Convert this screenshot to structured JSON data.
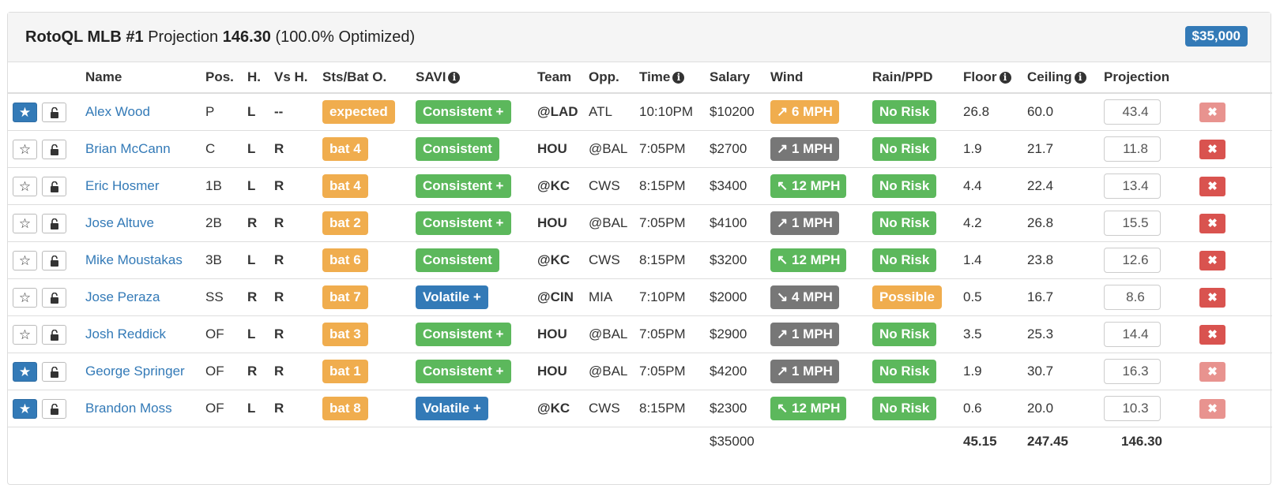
{
  "header": {
    "brand": "RotoQL MLB #1",
    "projection_label": "Projection",
    "projection_value": "146.30",
    "optimized": "(100.0% Optimized)",
    "budget": "$35,000"
  },
  "columns": {
    "name": "Name",
    "pos": "Pos.",
    "hand": "H.",
    "vs_hand": "Vs H.",
    "bat_order": "Sts/Bat O.",
    "savi": "SAVI",
    "team": "Team",
    "opp": "Opp.",
    "time": "Time",
    "salary": "Salary",
    "wind": "Wind",
    "rain": "Rain/PPD",
    "floor": "Floor",
    "ceiling": "Ceiling",
    "projection": "Projection"
  },
  "icons": {
    "info": "info-icon",
    "star": "star-icon",
    "lock": "unlock-icon",
    "remove": "close-icon",
    "wind_arrow": "wind-direction-arrow"
  },
  "colors": {
    "orange": "#f0ad4e",
    "green": "#5cb85c",
    "blue": "#337ab7",
    "gray": "#777777",
    "red": "#d9534f"
  },
  "players": [
    {
      "starred": true,
      "name": "Alex Wood",
      "pos": "P",
      "hand": "L",
      "vs_hand": "--",
      "bat": "expected",
      "savi": "Consistent +",
      "savi_color": "green",
      "team": "@LAD",
      "opp": "ATL",
      "time": "10:10PM",
      "salary": "$10200",
      "wind_arrow": "↗",
      "wind": "6 MPH",
      "wind_color": "orange",
      "rain": "No Risk",
      "rain_color": "green",
      "floor": "26.8",
      "ceiling": "60.0",
      "projection": "43.4",
      "remove_faded": true
    },
    {
      "starred": false,
      "name": "Brian McCann",
      "pos": "C",
      "hand": "L",
      "vs_hand": "R",
      "bat": "bat 4",
      "savi": "Consistent",
      "savi_color": "green",
      "team": "HOU",
      "opp": "@BAL",
      "time": "7:05PM",
      "salary": "$2700",
      "wind_arrow": "↗",
      "wind": "1 MPH",
      "wind_color": "gray",
      "rain": "No Risk",
      "rain_color": "green",
      "floor": "1.9",
      "ceiling": "21.7",
      "projection": "11.8",
      "remove_faded": false
    },
    {
      "starred": false,
      "name": "Eric Hosmer",
      "pos": "1B",
      "hand": "L",
      "vs_hand": "R",
      "bat": "bat 4",
      "savi": "Consistent +",
      "savi_color": "green",
      "team": "@KC",
      "opp": "CWS",
      "time": "8:15PM",
      "salary": "$3400",
      "wind_arrow": "↖",
      "wind": "12 MPH",
      "wind_color": "green",
      "rain": "No Risk",
      "rain_color": "green",
      "floor": "4.4",
      "ceiling": "22.4",
      "projection": "13.4",
      "remove_faded": false
    },
    {
      "starred": false,
      "name": "Jose Altuve",
      "pos": "2B",
      "hand": "R",
      "vs_hand": "R",
      "bat": "bat 2",
      "savi": "Consistent +",
      "savi_color": "green",
      "team": "HOU",
      "opp": "@BAL",
      "time": "7:05PM",
      "salary": "$4100",
      "wind_arrow": "↗",
      "wind": "1 MPH",
      "wind_color": "gray",
      "rain": "No Risk",
      "rain_color": "green",
      "floor": "4.2",
      "ceiling": "26.8",
      "projection": "15.5",
      "remove_faded": false
    },
    {
      "starred": false,
      "name": "Mike Moustakas",
      "pos": "3B",
      "hand": "L",
      "vs_hand": "R",
      "bat": "bat 6",
      "savi": "Consistent",
      "savi_color": "green",
      "team": "@KC",
      "opp": "CWS",
      "time": "8:15PM",
      "salary": "$3200",
      "wind_arrow": "↖",
      "wind": "12 MPH",
      "wind_color": "green",
      "rain": "No Risk",
      "rain_color": "green",
      "floor": "1.4",
      "ceiling": "23.8",
      "projection": "12.6",
      "remove_faded": false
    },
    {
      "starred": false,
      "name": "Jose Peraza",
      "pos": "SS",
      "hand": "R",
      "vs_hand": "R",
      "bat": "bat 7",
      "savi": "Volatile +",
      "savi_color": "blue",
      "team": "@CIN",
      "opp": "MIA",
      "time": "7:10PM",
      "salary": "$2000",
      "wind_arrow": "↘",
      "wind": "4 MPH",
      "wind_color": "gray",
      "rain": "Possible",
      "rain_color": "orange",
      "floor": "0.5",
      "ceiling": "16.7",
      "projection": "8.6",
      "remove_faded": false
    },
    {
      "starred": false,
      "name": "Josh Reddick",
      "pos": "OF",
      "hand": "L",
      "vs_hand": "R",
      "bat": "bat 3",
      "savi": "Consistent +",
      "savi_color": "green",
      "team": "HOU",
      "opp": "@BAL",
      "time": "7:05PM",
      "salary": "$2900",
      "wind_arrow": "↗",
      "wind": "1 MPH",
      "wind_color": "gray",
      "rain": "No Risk",
      "rain_color": "green",
      "floor": "3.5",
      "ceiling": "25.3",
      "projection": "14.4",
      "remove_faded": false
    },
    {
      "starred": true,
      "name": "George Springer",
      "pos": "OF",
      "hand": "R",
      "vs_hand": "R",
      "bat": "bat 1",
      "savi": "Consistent +",
      "savi_color": "green",
      "team": "HOU",
      "opp": "@BAL",
      "time": "7:05PM",
      "salary": "$4200",
      "wind_arrow": "↗",
      "wind": "1 MPH",
      "wind_color": "gray",
      "rain": "No Risk",
      "rain_color": "green",
      "floor": "1.9",
      "ceiling": "30.7",
      "projection": "16.3",
      "remove_faded": true
    },
    {
      "starred": true,
      "name": "Brandon Moss",
      "pos": "OF",
      "hand": "L",
      "vs_hand": "R",
      "bat": "bat 8",
      "savi": "Volatile +",
      "savi_color": "blue",
      "team": "@KC",
      "opp": "CWS",
      "time": "8:15PM",
      "salary": "$2300",
      "wind_arrow": "↖",
      "wind": "12 MPH",
      "wind_color": "green",
      "rain": "No Risk",
      "rain_color": "green",
      "floor": "0.6",
      "ceiling": "20.0",
      "projection": "10.3",
      "remove_faded": true
    }
  ],
  "totals": {
    "salary": "$35000",
    "floor": "45.15",
    "ceiling": "247.45",
    "projection": "146.30"
  }
}
